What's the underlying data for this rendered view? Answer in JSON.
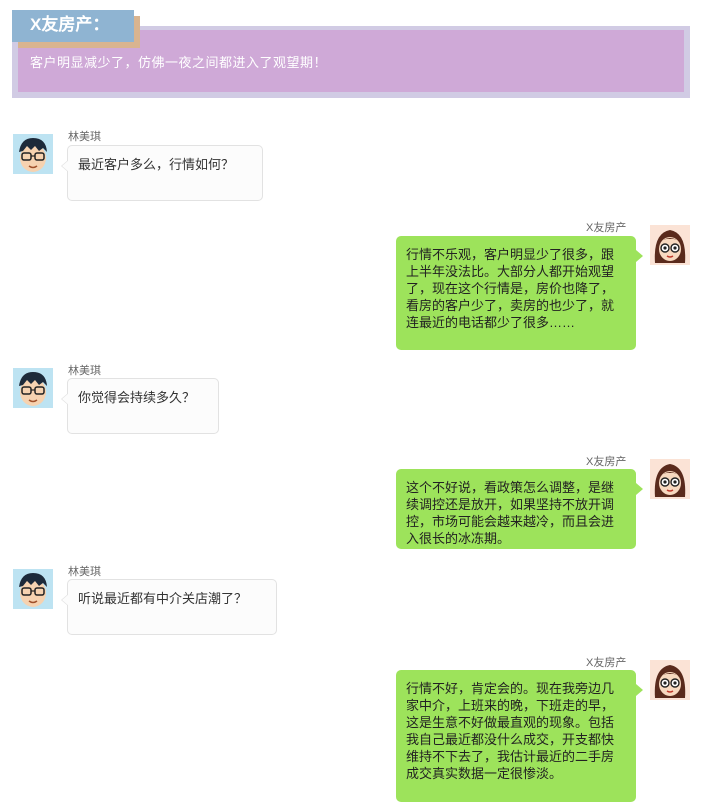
{
  "header": {
    "tag": "X友房产：",
    "subtitle": "客户明显减少了，仿佛一夜之间都进入了观望期！"
  },
  "colors": {
    "tag_bg": "#8fb4d2",
    "tag_shadow": "#d9b48f",
    "header_outer": "#d1cbe4",
    "header_inner": "#cfa9d7",
    "bubble_right": "#9de35b",
    "bubble_left": "#fcfcfc"
  },
  "messages": [
    {
      "side": "left",
      "avatar": "boy-avatar-icon",
      "name": "林美琪",
      "text": "最近客户多么，行情如何？"
    },
    {
      "side": "right",
      "avatar": "girl-avatar-icon",
      "name": "X友房产",
      "text": "行情不乐观，客户明显少了很多，跟上半年没法比。大部分人都开始观望了，现在这个行情是，房价也降了，看房的客户少了，卖房的也少了，就连最近的电话都少了很多……"
    },
    {
      "side": "left",
      "avatar": "boy-avatar-icon",
      "name": "林美琪",
      "text": "你觉得会持续多久？"
    },
    {
      "side": "right",
      "avatar": "girl-avatar-icon",
      "name": "X友房产",
      "text": "这个不好说，看政策怎么调整，是继续调控还是放开，如果坚持不放开调控，市场可能会越来越冷，而且会进入很长的冰冻期。"
    },
    {
      "side": "left",
      "avatar": "boy-avatar-icon",
      "name": "林美琪",
      "text": "听说最近都有中介关店潮了？"
    },
    {
      "side": "right",
      "avatar": "girl-avatar-icon",
      "name": "X友房产",
      "text": "行情不好，肯定会的。现在我旁边几家中介，上班来的晚，下班走的早，这是生意不好做最直观的现象。包括我自己最近都没什么成交，开支都快维持不下去了，我估计最近的二手房成交真实数据一定很惨淡。"
    }
  ]
}
